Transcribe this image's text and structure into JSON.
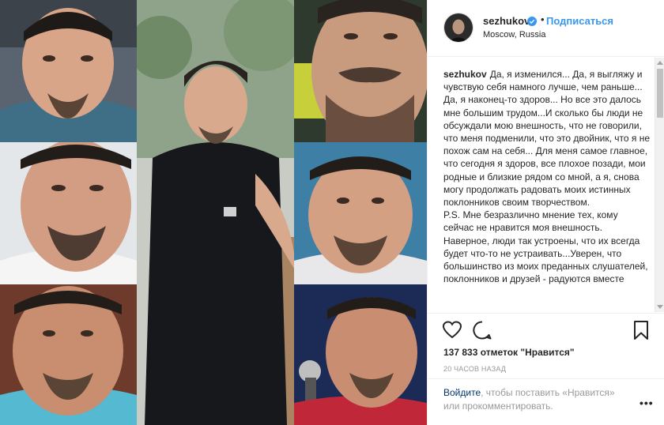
{
  "post": {
    "username": "sezhukov",
    "follow_label": "Подписаться",
    "dot": "•",
    "location": "Moscow, Russia",
    "caption_paragraphs": [
      "Да, я изменился... Да, я выгляжу и чувствую себя намного лучше, чем раньше... Да, я наконец-то здоров... Но все это далось мне большим трудом...И сколько бы люди не обсуждали мою внешность, что не говорили, что меня подменили, что это двойник, что я не похож сам на себя... Для меня самое главное, что сегодня я здоров, все плохое позади, мои родные и близкие рядом со мной, а я, снова могу продолжать радовать моих истинных поклонников своим творчеством.",
      "P.S. Мне безразлично мнение тех, кому сейчас не нравится моя внешность. Наверное, люди так устроены, что их всегда будет что-то не устраивать...Уверен, что большинство из моих преданных слушателей, поклонников и друзей - радуются вместе"
    ],
    "likes": "137 833 отметок \"Нравится\"",
    "time": "20 ЧАСОВ НАЗАД",
    "login_link": "Войдите",
    "login_rest": ", чтобы поставить «Нравится» или прокомментировать.",
    "more": "•••"
  },
  "icons": {
    "verified": "verified-badge-icon",
    "like": "heart-icon",
    "comment": "comment-bubble-icon",
    "bookmark": "bookmark-icon"
  },
  "colors": {
    "accent": "#3897f0",
    "link": "#003569",
    "text": "#262626",
    "muted": "#999999"
  }
}
